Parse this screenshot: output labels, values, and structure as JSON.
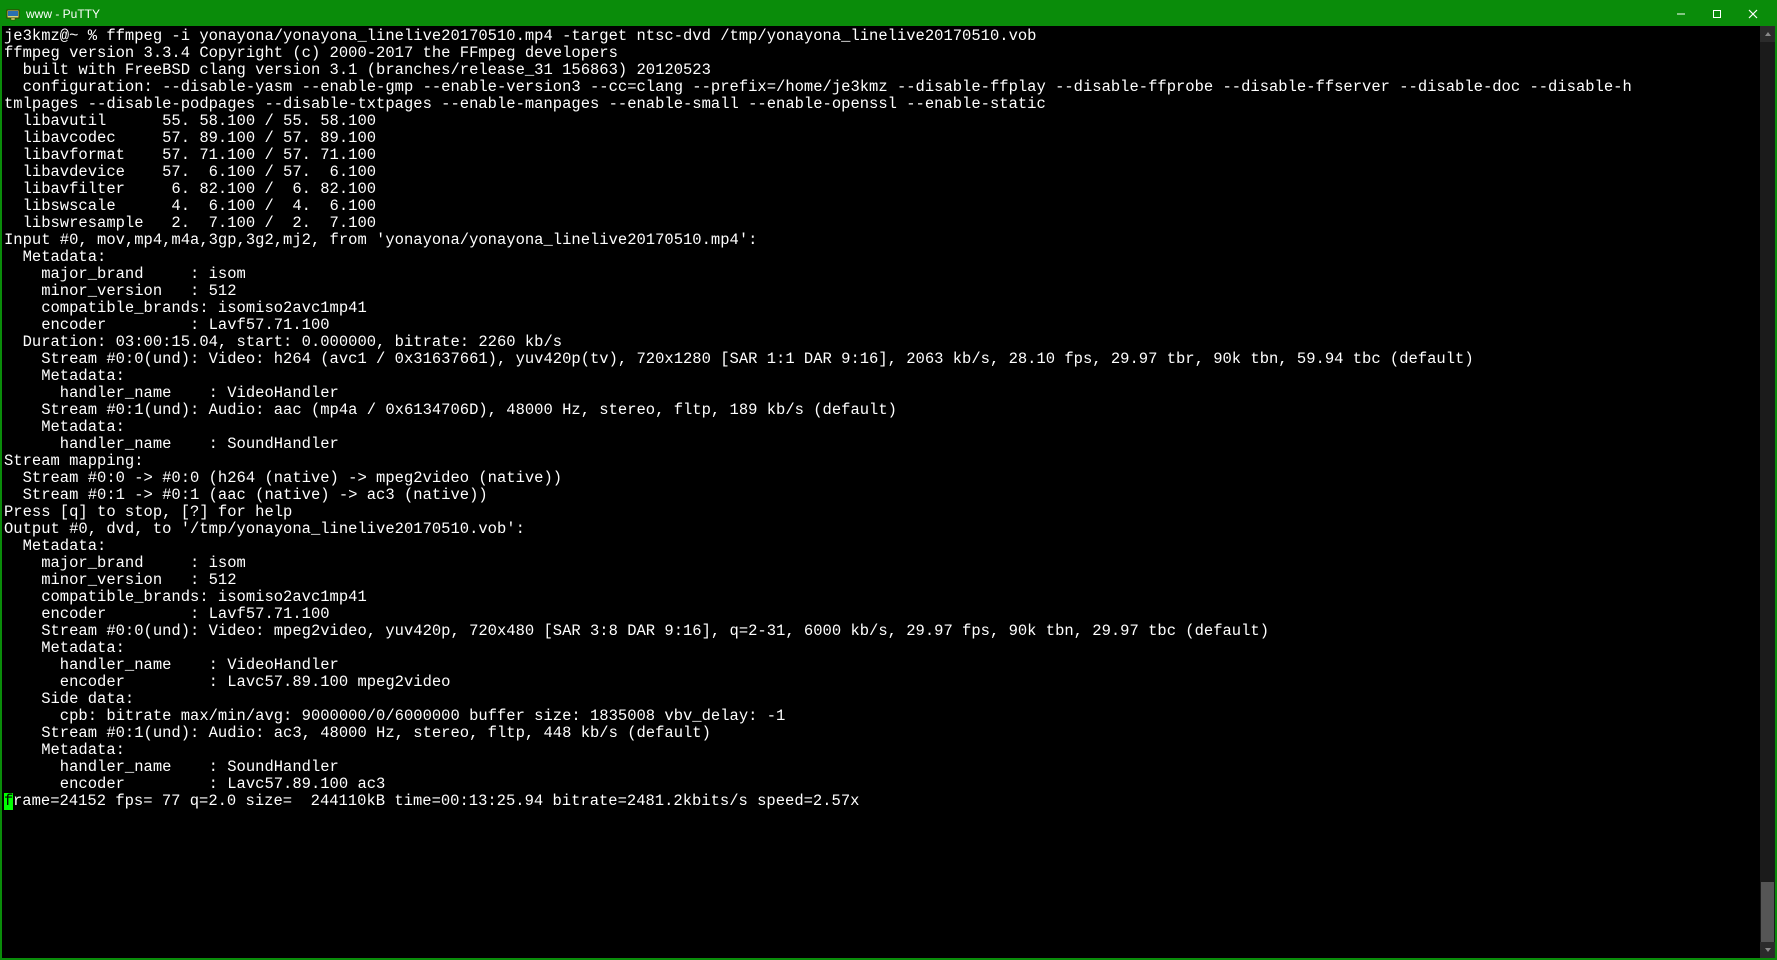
{
  "titlebar": {
    "title": "www - PuTTY"
  },
  "terminal": {
    "lines": [
      "je3kmz@~ % ffmpeg -i yonayona/yonayona_linelive20170510.mp4 -target ntsc-dvd /tmp/yonayona_linelive20170510.vob",
      "ffmpeg version 3.3.4 Copyright (c) 2000-2017 the FFmpeg developers",
      "  built with FreeBSD clang version 3.1 (branches/release_31 156863) 20120523",
      "  configuration: --disable-yasm --enable-gmp --enable-version3 --cc=clang --prefix=/home/je3kmz --disable-ffplay --disable-ffprobe --disable-ffserver --disable-doc --disable-h",
      "tmlpages --disable-podpages --disable-txtpages --enable-manpages --enable-small --enable-openssl --enable-static",
      "  libavutil      55. 58.100 / 55. 58.100",
      "  libavcodec     57. 89.100 / 57. 89.100",
      "  libavformat    57. 71.100 / 57. 71.100",
      "  libavdevice    57.  6.100 / 57.  6.100",
      "  libavfilter     6. 82.100 /  6. 82.100",
      "  libswscale      4.  6.100 /  4.  6.100",
      "  libswresample   2.  7.100 /  2.  7.100",
      "Input #0, mov,mp4,m4a,3gp,3g2,mj2, from 'yonayona/yonayona_linelive20170510.mp4':",
      "  Metadata:",
      "    major_brand     : isom",
      "    minor_version   : 512",
      "    compatible_brands: isomiso2avc1mp41",
      "    encoder         : Lavf57.71.100",
      "  Duration: 03:00:15.04, start: 0.000000, bitrate: 2260 kb/s",
      "    Stream #0:0(und): Video: h264 (avc1 / 0x31637661), yuv420p(tv), 720x1280 [SAR 1:1 DAR 9:16], 2063 kb/s, 28.10 fps, 29.97 tbr, 90k tbn, 59.94 tbc (default)",
      "    Metadata:",
      "      handler_name    : VideoHandler",
      "    Stream #0:1(und): Audio: aac (mp4a / 0x6134706D), 48000 Hz, stereo, fltp, 189 kb/s (default)",
      "    Metadata:",
      "      handler_name    : SoundHandler",
      "Stream mapping:",
      "  Stream #0:0 -> #0:0 (h264 (native) -> mpeg2video (native))",
      "  Stream #0:1 -> #0:1 (aac (native) -> ac3 (native))",
      "Press [q] to stop, [?] for help",
      "Output #0, dvd, to '/tmp/yonayona_linelive20170510.vob':",
      "  Metadata:",
      "    major_brand     : isom",
      "    minor_version   : 512",
      "    compatible_brands: isomiso2avc1mp41",
      "    encoder         : Lavf57.71.100",
      "    Stream #0:0(und): Video: mpeg2video, yuv420p, 720x480 [SAR 3:8 DAR 9:16], q=2-31, 6000 kb/s, 29.97 fps, 90k tbn, 29.97 tbc (default)",
      "    Metadata:",
      "      handler_name    : VideoHandler",
      "      encoder         : Lavc57.89.100 mpeg2video",
      "    Side data:",
      "      cpb: bitrate max/min/avg: 9000000/0/6000000 buffer size: 1835008 vbv_delay: -1",
      "    Stream #0:1(und): Audio: ac3, 48000 Hz, stereo, fltp, 448 kb/s (default)",
      "    Metadata:",
      "      handler_name    : SoundHandler",
      "      encoder         : Lavc57.89.100 ac3"
    ],
    "status_prefix_char": "f",
    "status_rest": "rame=24152 fps= 77 q=2.0 size=  244110kB time=00:13:25.94 bitrate=2481.2kbits/s speed=2.57x"
  }
}
